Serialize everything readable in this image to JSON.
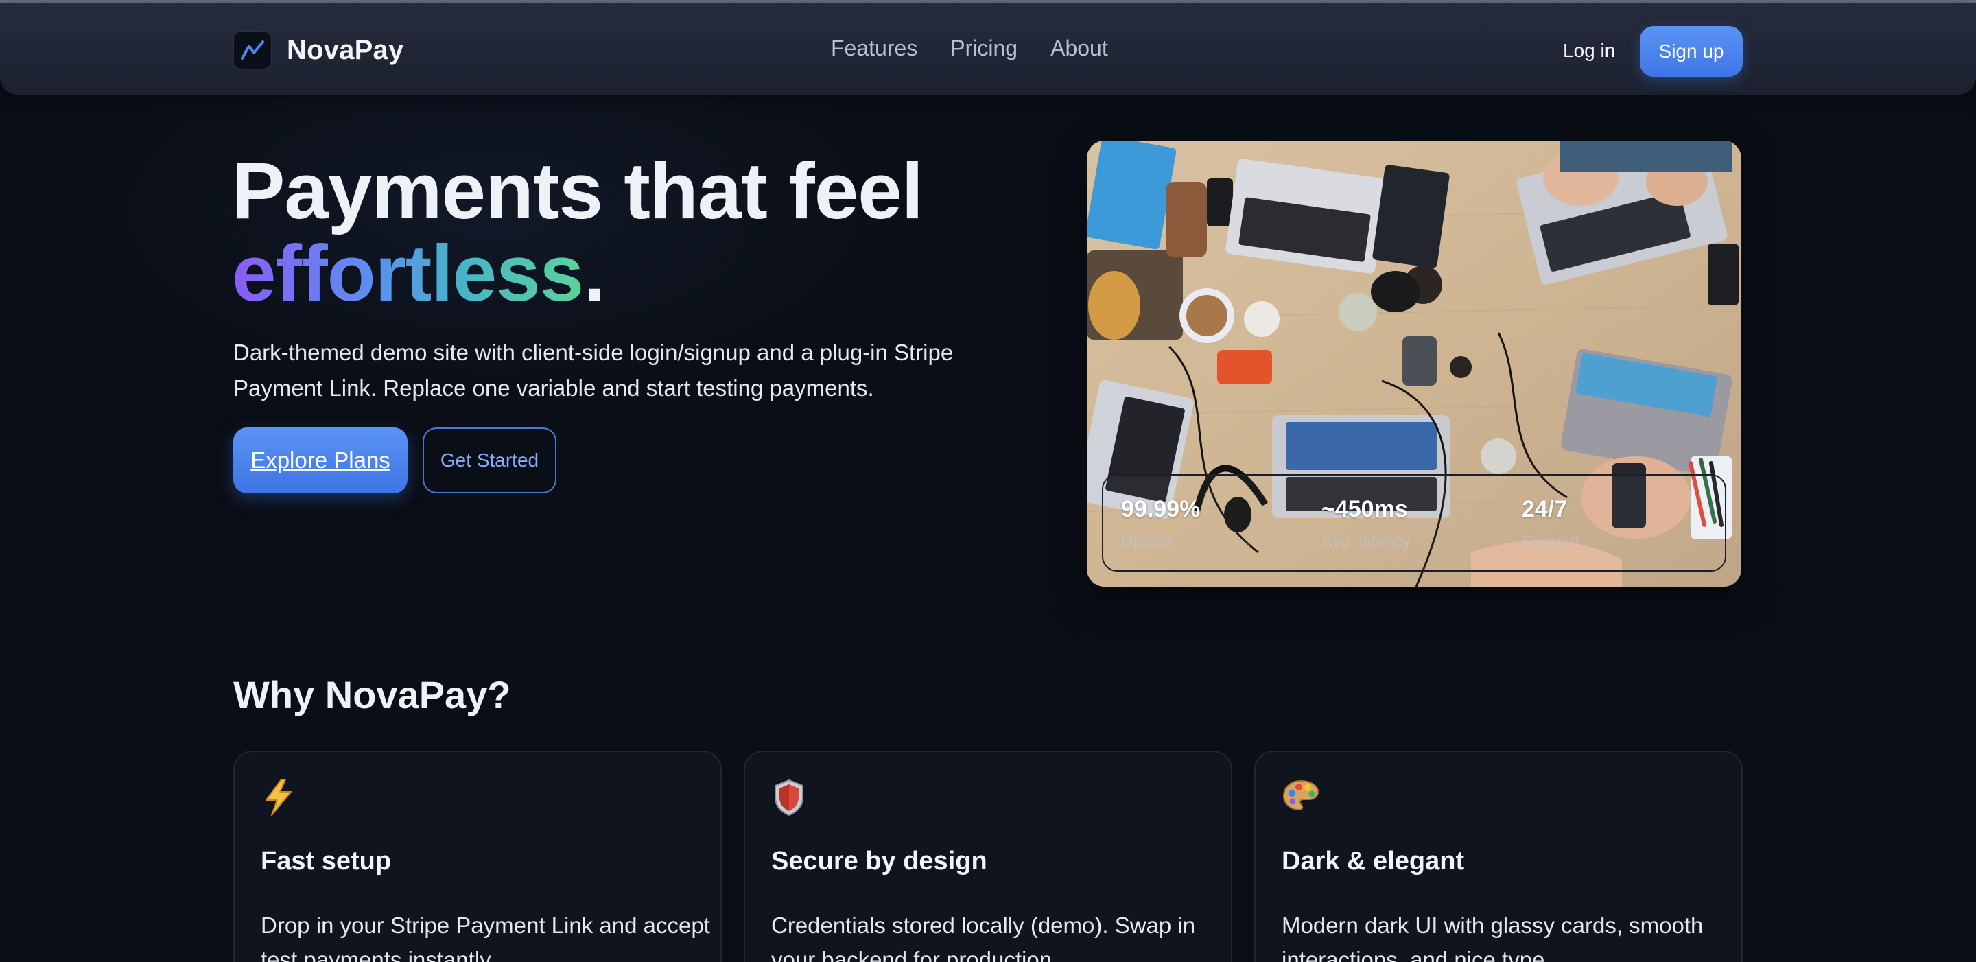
{
  "brand": {
    "name": "NovaPay"
  },
  "nav": {
    "links": [
      "Features",
      "Pricing",
      "About"
    ],
    "login": "Log in",
    "signup": "Sign up"
  },
  "hero": {
    "title_line1": "Payments that feel",
    "title_accent": "effortless",
    "title_period": ".",
    "lead": "Dark-themed demo site with client-side login/signup and a plug-in Stripe Payment Link. Replace one variable and start testing payments.",
    "primary_cta": "Explore Plans",
    "secondary_cta": "Get Started",
    "stats": [
      {
        "value": "99.99%",
        "label": "Uptime"
      },
      {
        "value": "~450ms",
        "label": "Avg. latency"
      },
      {
        "value": "24/7",
        "label": "Support"
      }
    ]
  },
  "features": {
    "title": "Why NovaPay?",
    "cards": [
      {
        "icon": "lightning-icon",
        "title": "Fast setup",
        "text": "Drop in your Stripe Payment Link and accept test payments instantly."
      },
      {
        "icon": "shield-icon",
        "title": "Secure by design",
        "text": "Credentials stored locally (demo). Swap in your backend for production."
      },
      {
        "icon": "palette-icon",
        "title": "Dark & elegant",
        "text": "Modern dark UI with glassy cards, smooth interactions, and nice type."
      }
    ]
  },
  "colors": {
    "accent": "#3f76e6",
    "background": "#0a0e16",
    "gradient": [
      "#8b5cf6",
      "#5b8ff0",
      "#48b3c8",
      "#5cd39a"
    ]
  }
}
